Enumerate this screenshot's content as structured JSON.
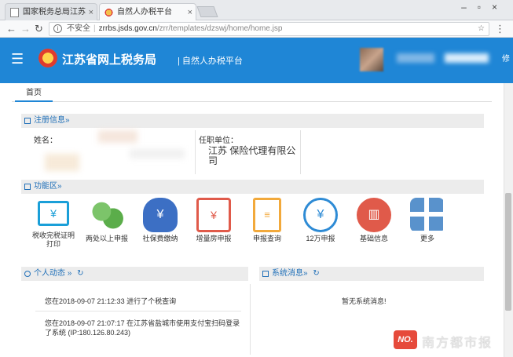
{
  "browser": {
    "tabs": [
      {
        "title": "国家税务总局江苏省税务..."
      },
      {
        "title": "自然人办税平台"
      }
    ],
    "address": {
      "security_label": "不安全",
      "host": "zrrbs.jsds.gov.cn",
      "path": "/zrr/templates/dzswj/home/home.jsp"
    }
  },
  "header": {
    "title": "江苏省网上税务局",
    "subtitle": "自然人办税平台",
    "right_fragment": "修"
  },
  "page_tabs": [
    {
      "label": "首页"
    }
  ],
  "registration": {
    "section_title": "注册信息»",
    "name_label": "姓名：",
    "employer_label": "任职单位：",
    "employer_value": "江苏 保险代理有限公司"
  },
  "functions": {
    "section_title": "功能区»",
    "tiles": [
      {
        "label": "税收完税证明打印",
        "icon": "monitor-yen-icon",
        "color": "#1a9fd8"
      },
      {
        "label": "两处以上申报",
        "icon": "coins-stack-icon",
        "color": "#5bad4a"
      },
      {
        "label": "社保费缴纳",
        "icon": "money-bag-icon",
        "color": "#3c6fc4"
      },
      {
        "label": "增量房申报",
        "icon": "house-yen-icon",
        "color": "#e05a4a"
      },
      {
        "label": "申报查询",
        "icon": "document-search-icon",
        "color": "#f2a93b"
      },
      {
        "label": "12万申报",
        "icon": "yen-circle-icon",
        "color": "#2e8bd5"
      },
      {
        "label": "基础信息",
        "icon": "folders-icon",
        "color": "#e05a4a"
      },
      {
        "label": "更多",
        "icon": "grid-icon",
        "color": "#3d7fc4"
      }
    ]
  },
  "activity": {
    "section_title": "个人动态 »",
    "items": [
      {
        "text": "您在2018-09-07 21:12:33 进行了个税查询"
      },
      {
        "text": "您在2018-09-07 21:07:17 在江苏省盐城市使用支付宝扫码登录了系统 (IP:180.126.80.243)"
      }
    ]
  },
  "messages": {
    "section_title": "系统消息»",
    "empty_text": "暂无系统消息!"
  },
  "watermark": {
    "logo": "NO.",
    "text": "南方都市报"
  }
}
